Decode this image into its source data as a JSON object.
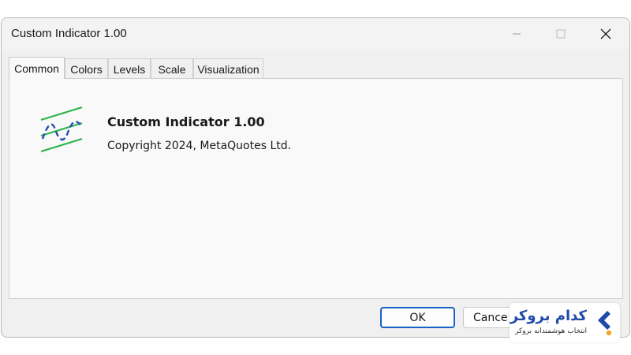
{
  "window": {
    "title": "Custom Indicator 1.00"
  },
  "tabs": [
    {
      "label": "Common",
      "active": true
    },
    {
      "label": "Colors",
      "active": false
    },
    {
      "label": "Levels",
      "active": false
    },
    {
      "label": "Scale",
      "active": false
    },
    {
      "label": "Visualization",
      "active": false
    }
  ],
  "common": {
    "icon": "indicator-wave-icon",
    "indicator_name": "Custom Indicator 1.00",
    "copyright": "Copyright 2024, MetaQuotes Ltd."
  },
  "buttons": {
    "ok": "OK",
    "cancel": "Cance"
  },
  "watermark": {
    "brand": "کدام بروکر",
    "tagline": "انتخاب هوشمندانه بروکر",
    "icon": "brand-chevron-icon"
  },
  "colors": {
    "accent": "#1b5fc8",
    "icon_green": "#2bb34a",
    "icon_blue": "#2450b0",
    "brand_blue": "#1f4aa8",
    "brand_orange": "#f5a623"
  }
}
